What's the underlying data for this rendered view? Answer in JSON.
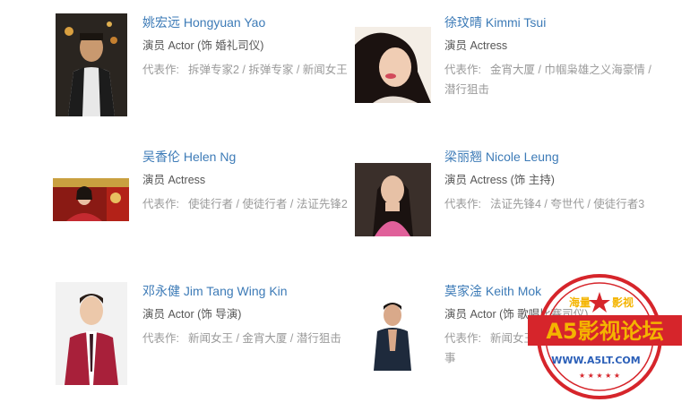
{
  "cast": [
    {
      "name": "姚宏远 Hongyuan Yao",
      "role": "演员 Actor (饰 婚礼司仪)",
      "works_label": "代表作:",
      "works": [
        "拆弹专家2",
        "拆弹专家",
        "新闻女王"
      ]
    },
    {
      "name": "徐玟晴 Kimmi Tsui",
      "role": "演员 Actress",
      "works_label": "代表作:",
      "works": [
        "金宵大厦",
        "巾帼枭雄之义海豪情",
        "潜行狙击"
      ]
    },
    {
      "name": "吴香伦 Helen Ng",
      "role": "演员 Actress",
      "works_label": "代表作:",
      "works": [
        "使徒行者",
        "使徒行者",
        "法证先锋2"
      ]
    },
    {
      "name": "梁丽翘 Nicole Leung",
      "role": "演员 Actress (饰 主持)",
      "works_label": "代表作:",
      "works": [
        "法证先锋4",
        "夸世代",
        "使徒行者3"
      ]
    },
    {
      "name": "邓永健 Jim Tang Wing Kin",
      "role": "演员 Actor (饰 导演)",
      "works_label": "代表作:",
      "works": [
        "新闻女王",
        "金宵大厦",
        "潜行狙击"
      ]
    },
    {
      "name": "莫家淦 Keith Mok",
      "role": "演员 Actor (饰 歌唱比赛司仪)",
      "works_label": "代表作:",
      "works": [
        "新闻女王",
        "金宵大厦",
        "香港爱情故事"
      ]
    }
  ],
  "separator": " / ",
  "watermark": {
    "top_left": "海量",
    "top_right": "影视",
    "title": "A5影视论坛",
    "url": "WWW.A5LT.COM"
  },
  "colors": {
    "link": "#3d7bb7",
    "muted": "#9a9a9a",
    "seal_red": "#d6252b",
    "seal_gold": "#f4b400"
  }
}
